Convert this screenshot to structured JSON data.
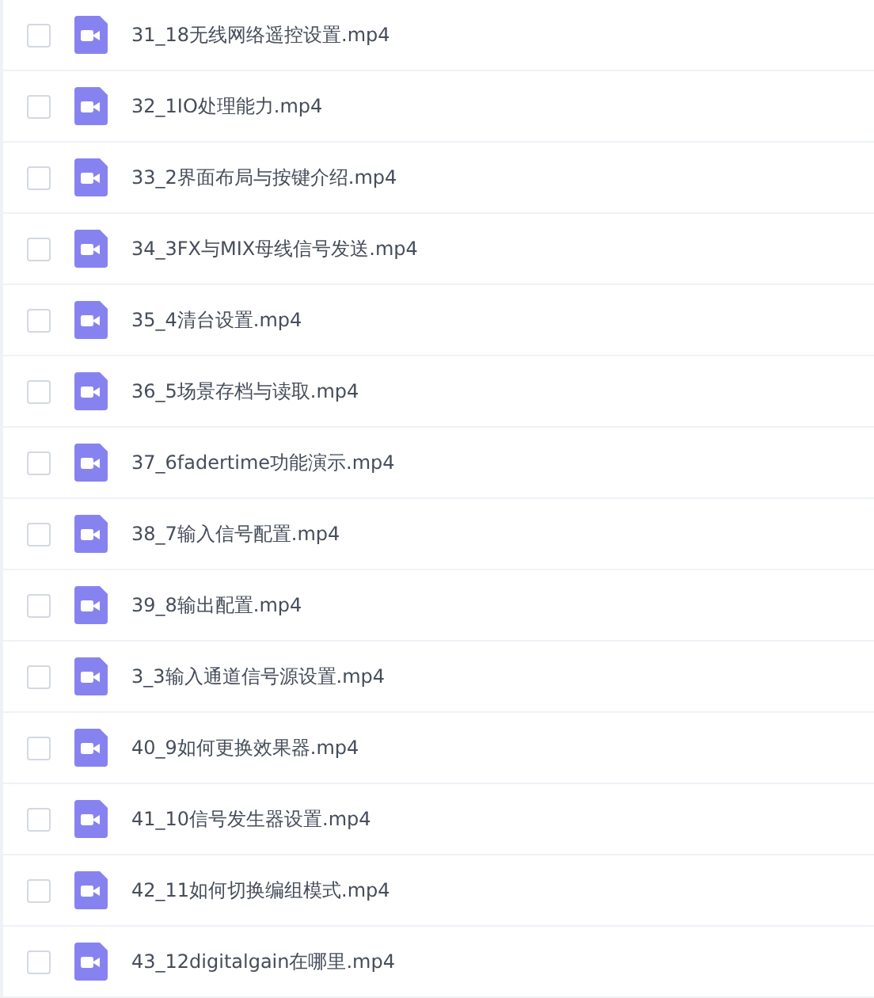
{
  "files": [
    {
      "name": "31_18无线网络遥控设置.mp4",
      "checked": false
    },
    {
      "name": "32_1IO处理能力.mp4",
      "checked": false
    },
    {
      "name": "33_2界面布局与按键介绍.mp4",
      "checked": false
    },
    {
      "name": "34_3FX与MIX母线信号发送.mp4",
      "checked": false
    },
    {
      "name": "35_4清台设置.mp4",
      "checked": false
    },
    {
      "name": "36_5场景存档与读取.mp4",
      "checked": false
    },
    {
      "name": "37_6fadertime功能演示.mp4",
      "checked": false
    },
    {
      "name": "38_7输入信号配置.mp4",
      "checked": false
    },
    {
      "name": "39_8输出配置.mp4",
      "checked": false
    },
    {
      "name": "3_3输入通道信号源设置.mp4",
      "checked": false
    },
    {
      "name": "40_9如何更换效果器.mp4",
      "checked": false
    },
    {
      "name": "41_10信号发生器设置.mp4",
      "checked": false
    },
    {
      "name": "42_11如何切换编组模式.mp4",
      "checked": false
    },
    {
      "name": "43_12digitalgain在哪里.mp4",
      "checked": false
    }
  ]
}
